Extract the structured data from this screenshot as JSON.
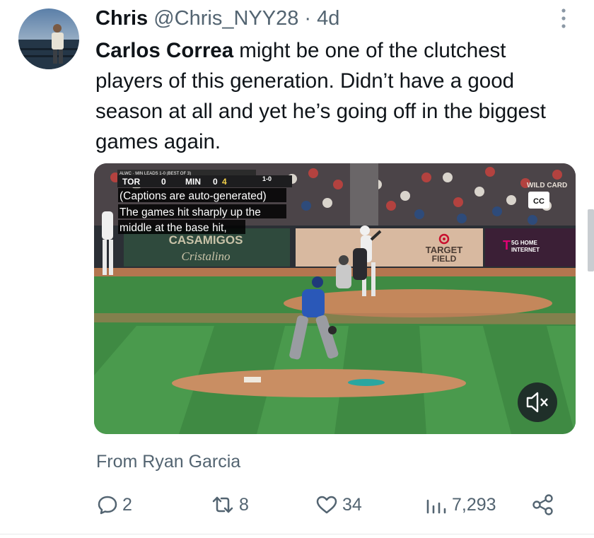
{
  "tweet": {
    "display_name": "Chris",
    "handle": "@Chris_NYY28",
    "separator": "·",
    "time": "4d",
    "text_bold": "Carlos Correa",
    "text_rest": " might be one of the clutchest players of this generation. Didn’t have a good season at all and yet he’s going off in the biggest games again."
  },
  "video": {
    "scorebug_top": "ALWC · MIN LEADS 1-0 (BEST OF 3)",
    "away_team": "TOR",
    "away_score": "0",
    "home_team": "MIN",
    "home_score": "0",
    "inning": "4",
    "count": "1-0",
    "caption_line1": "(Captions are auto-generated)",
    "caption_line2": "The games hit sharply up the",
    "caption_line3": "middle at the base hit,",
    "cc_label": "CC",
    "ad_casamigos_1": "CASAMIGOS",
    "ad_casamigos_2": "Cristalino",
    "ad_target_1": "TARGET",
    "ad_target_2": "FIELD",
    "ad_tmobile_1": "5G HOME",
    "ad_tmobile_2": "INTERNET",
    "ad_wildcard": "WILD CARD",
    "mute_icon": "speaker-muted-icon"
  },
  "attribution": "From Ryan Garcia",
  "actions": {
    "replies": "2",
    "retweets": "8",
    "likes": "34",
    "views": "7,293"
  },
  "colors": {
    "text_primary": "#0f1419",
    "text_secondary": "#536471",
    "field_grass": "#3f8a43",
    "dirt": "#c4875b"
  }
}
